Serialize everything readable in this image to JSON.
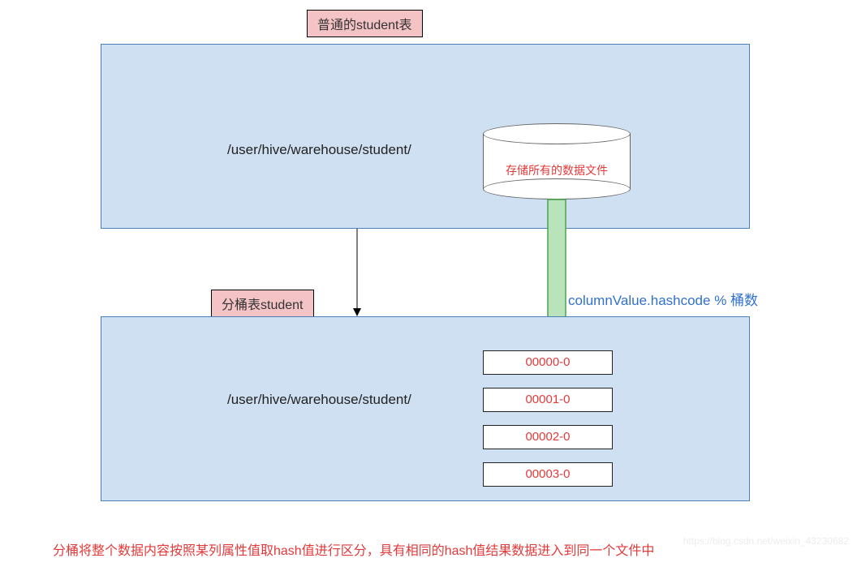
{
  "topTitle": "普通的student表",
  "midTitle": "分桶表student",
  "box1": {
    "path": "/user/hive/warehouse/student/"
  },
  "box2": {
    "path": "/user/hive/warehouse/student/"
  },
  "cylinder": {
    "label": "存储所有的数据文件"
  },
  "formula": "columnValue.hashcode % 桶数",
  "files": [
    "00000-0",
    "00001-0",
    "00002-0",
    "00003-0"
  ],
  "bottomText": "分桶将整个数据内容按照某列属性值取hash值进行区分，具有相同的hash值结果数据进入到同一个文件中",
  "watermark": "https://blog.csdn.net/weixin_43230682"
}
